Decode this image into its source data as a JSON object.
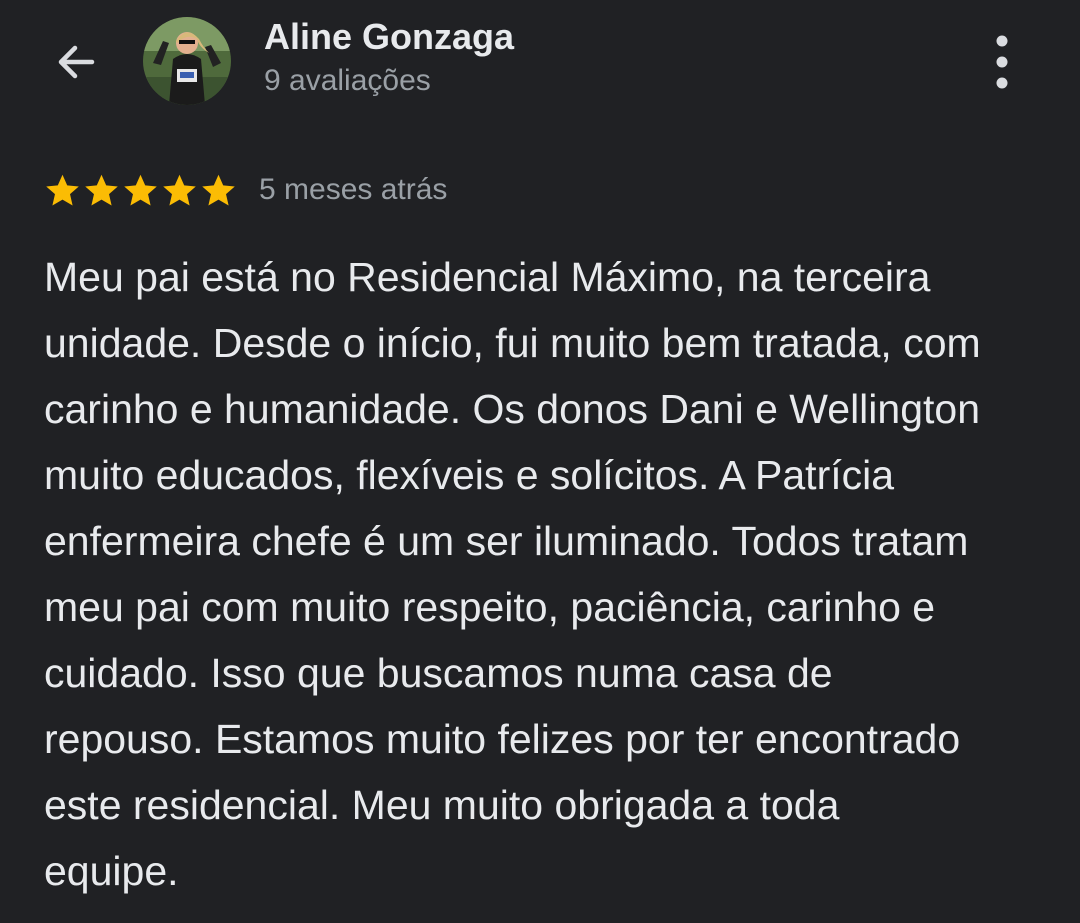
{
  "header": {
    "back_icon": "arrow-left-icon",
    "menu_icon": "more-vert-icon",
    "reviewer_name": "Aline Gonzaga",
    "review_count": "9 avaliações"
  },
  "review": {
    "rating": 5,
    "rating_max": 5,
    "star_color": "#fbbc04",
    "time_ago": "5 meses atrás",
    "text": "Meu pai está no Residencial Máximo, na terceira\nunidade. Desde o início, fui muito bem tratada, com\ncarinho e humanidade. Os donos Dani e Wellington\nmuito educados, flexíveis e solícitos. A Patrícia\nenfermeira chefe é um ser iluminado. Todos tratam\nmeu pai com muito respeito, paciência, carinho e\ncuidado. Isso que buscamos numa casa de\nrepouso. Estamos muito felizes por ter encontrado\neste residencial. Meu muito obrigada a toda\nequipe."
  }
}
